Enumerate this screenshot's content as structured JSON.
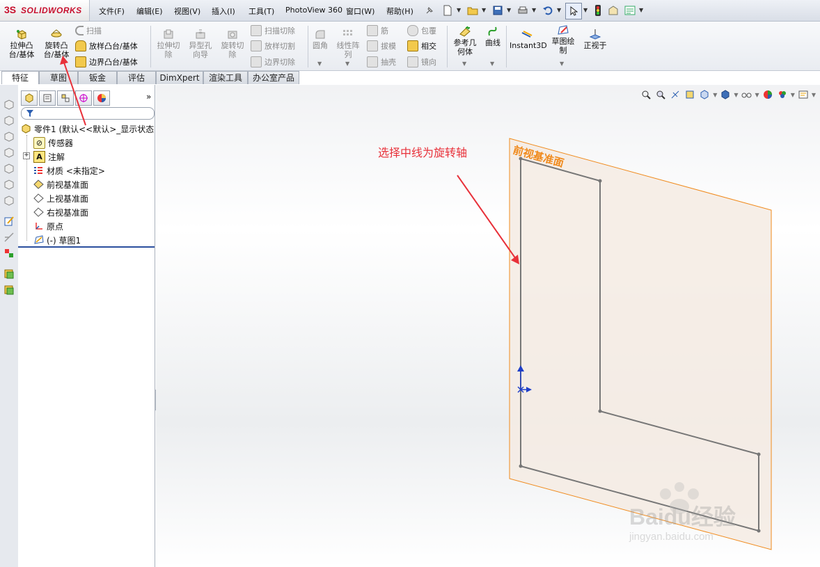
{
  "app": {
    "logo_ds": "3S",
    "logo_name": "SOLIDWORKS"
  },
  "menu": [
    "文件(F)",
    "编辑(E)",
    "视图(V)",
    "插入(I)",
    "工具(T)",
    "PhotoView 360",
    "窗口(W)",
    "帮助(H)"
  ],
  "ribbon": {
    "extrude_boss": "拉伸凸\n台/基体",
    "revolve_boss": "旋转凸\n台/基体",
    "sweep": "扫描",
    "loft_boss": "放样凸台/基体",
    "boundary_boss": "边界凸台/基体",
    "extrude_cut": "拉伸切\n除",
    "hole_wizard": "异型孔\n向导",
    "revolve_cut": "旋转切\n除",
    "sweep_cut": "扫描切除",
    "loft_cut": "放样切割",
    "boundary_cut": "边界切除",
    "fillet": "圆角",
    "linear_pattern": "线性阵\n列",
    "rib": "筋",
    "draft": "拔模",
    "shell": "抽壳",
    "wrap": "包覆",
    "intersect": "相交",
    "mirror": "镜向",
    "ref_geometry": "参考几\n何体",
    "curves": "曲线",
    "instant3d": "Instant3D",
    "sketch": "草图绘\n制",
    "normal_to": "正视于"
  },
  "tabs": [
    "特征",
    "草图",
    "钣金",
    "评估",
    "DimXpert",
    "渲染工具",
    "办公室产品"
  ],
  "tree": {
    "root": "零件1 (默认<<默认>_显示状态",
    "items": [
      {
        "label": "传感器",
        "icon": "sensor-icon"
      },
      {
        "label": "注解",
        "icon": "annotation-icon"
      },
      {
        "label": "材质 <未指定>",
        "icon": "material-icon"
      },
      {
        "label": "前视基准面",
        "icon": "plane-icon"
      },
      {
        "label": "上视基准面",
        "icon": "plane-icon"
      },
      {
        "label": "右视基准面",
        "icon": "plane-icon"
      },
      {
        "label": "原点",
        "icon": "origin-icon"
      },
      {
        "label": "(-) 草图1",
        "icon": "sketch-icon"
      }
    ]
  },
  "viewport": {
    "plane_label": "前视基准面",
    "annotation": "选择中线为旋转轴",
    "watermark_brand": "Baidu经验",
    "watermark_url": "jingyan.baidu.com"
  },
  "colors": {
    "annotation_red": "#e8313a",
    "plane_orange": "#f08a1c",
    "logo_red": "#c8102e"
  }
}
